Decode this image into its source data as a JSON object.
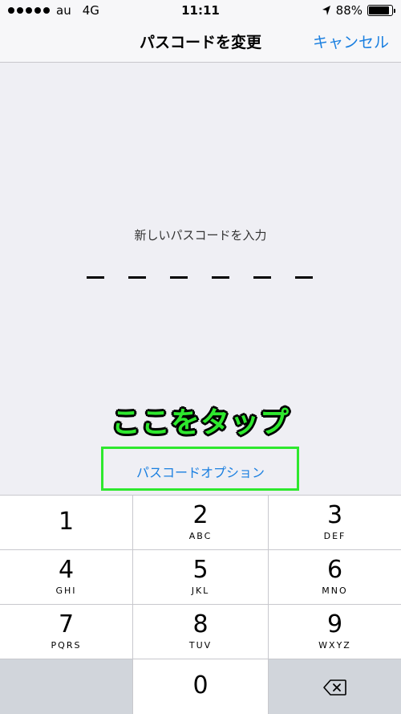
{
  "status_bar": {
    "carrier": "au",
    "network": "4G",
    "time": "11:11",
    "battery": "88%",
    "battery_level": 0.88
  },
  "nav": {
    "title": "パスコードを変更",
    "cancel": "キャンセル"
  },
  "prompt": "新しいパスコードを入力",
  "annotation": "ここをタップ",
  "passcode_options": "パスコードオプション",
  "keypad": {
    "keys": [
      {
        "num": "1",
        "letters": ""
      },
      {
        "num": "2",
        "letters": "ABC"
      },
      {
        "num": "3",
        "letters": "DEF"
      },
      {
        "num": "4",
        "letters": "GHI"
      },
      {
        "num": "5",
        "letters": "JKL"
      },
      {
        "num": "6",
        "letters": "MNO"
      },
      {
        "num": "7",
        "letters": "PQRS"
      },
      {
        "num": "8",
        "letters": "TUV"
      },
      {
        "num": "9",
        "letters": "WXYZ"
      },
      {
        "num": "0",
        "letters": ""
      }
    ],
    "delete_icon": "backspace-icon"
  },
  "colors": {
    "accent": "#1a7fe0",
    "highlight": "#2ee82e"
  }
}
